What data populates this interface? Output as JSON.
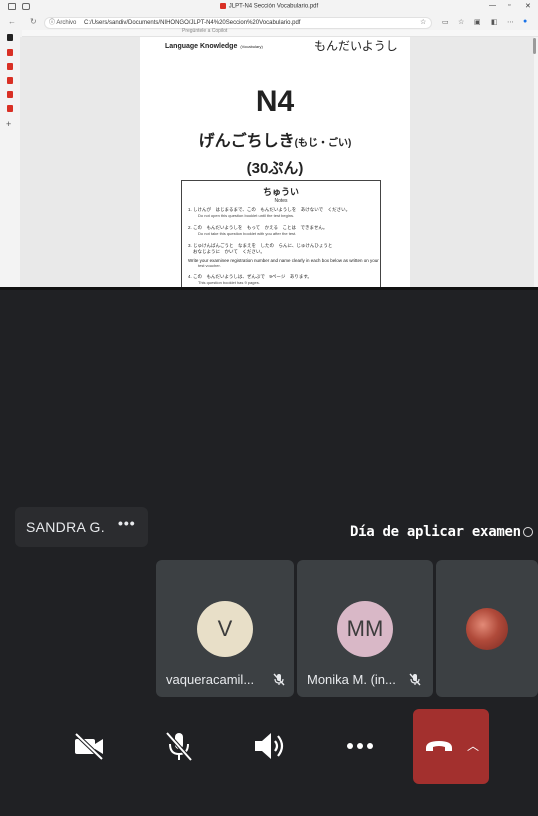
{
  "browser": {
    "tab_title": "JLPT-N4 Sección Vocabulario.pdf",
    "address_label": "Archivo",
    "url": "C:/Users/sandiv/Documents/NIHONGO/JLPT-N4%20Seccion%20Vocabulario.pdf",
    "toolbar_hint": "Pregúntele a Copilot"
  },
  "document": {
    "header_label": "Language Knowledge",
    "header_label_small": "(Vocabulary)",
    "header_jp": "もんだいようし",
    "level": "N4",
    "section_title": "げんごちしき",
    "section_title_small": "(もじ・ごい)",
    "duration": "(30ぷん)",
    "notes_title": "ちゅうい",
    "notes_subtitle": "Notes",
    "notes": [
      {
        "jp": "1.  しけんが　はじまるまで、この　もんだいようしを　あけないで　ください。",
        "en": "Do not open this question booklet until the test begins."
      },
      {
        "jp": "2.  この　もんだいようしを　もって　かえる　ことは　できません。",
        "en": "Do not take this question booklet with you after the test."
      },
      {
        "jp": "3.  じゅけんばんごうと　なまえを　したの　らんに、じゅけんひょうと",
        "en": "おなじように　かいて　ください。"
      },
      {
        "jp": "    Write your examinee registration number and name clearly in each box below as written on your",
        "en": "test voucher."
      },
      {
        "jp": "4.  この　もんだいようしは、ぜんぶで　9ページ　あります。",
        "en": "This question booklet has 9 pages."
      }
    ]
  },
  "meeting": {
    "presenter_name": "SANDRA G.",
    "caption": "Día de aplicar examen",
    "participants": [
      {
        "initials": "V",
        "name": "vaqueracamil...",
        "avatar_color": "#e8dfc8",
        "muted": true
      },
      {
        "initials": "MM",
        "name": "Monika M. (in...",
        "avatar_color": "#d9b8c7",
        "muted": true
      }
    ]
  },
  "colors": {
    "end_call": "#a3302e",
    "tile_bg": "#3c4043",
    "background": "#202124"
  },
  "icons": [
    "camera-off-icon",
    "mic-off-icon",
    "speaker-icon",
    "more-options-icon",
    "end-call-icon",
    "chevron-up-icon"
  ]
}
